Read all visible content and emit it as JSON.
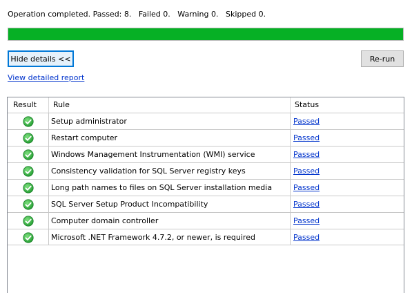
{
  "summary": {
    "text": "Operation completed. Passed: 8.   Failed 0.   Warning 0.   Skipped 0."
  },
  "progress": {
    "percent": 100,
    "color": "#06b025"
  },
  "buttons": {
    "hide_details": "Hide details <<",
    "rerun": "Re-run"
  },
  "links": {
    "view_report": "View detailed report"
  },
  "table": {
    "headers": {
      "result": "Result",
      "rule": "Rule",
      "status": "Status"
    },
    "rows": [
      {
        "result_icon": "check-circle-icon",
        "rule": "Setup administrator",
        "status": "Passed"
      },
      {
        "result_icon": "check-circle-icon",
        "rule": "Restart computer",
        "status": "Passed"
      },
      {
        "result_icon": "check-circle-icon",
        "rule": "Windows Management Instrumentation (WMI) service",
        "status": "Passed"
      },
      {
        "result_icon": "check-circle-icon",
        "rule": "Consistency validation for SQL Server registry keys",
        "status": "Passed"
      },
      {
        "result_icon": "check-circle-icon",
        "rule": "Long path names to files on SQL Server installation media",
        "status": "Passed"
      },
      {
        "result_icon": "check-circle-icon",
        "rule": "SQL Server Setup Product Incompatibility",
        "status": "Passed"
      },
      {
        "result_icon": "check-circle-icon",
        "rule": "Computer domain controller",
        "status": "Passed"
      },
      {
        "result_icon": "check-circle-icon",
        "rule": "Microsoft .NET Framework 4.7.2, or newer, is required",
        "status": "Passed"
      }
    ]
  }
}
